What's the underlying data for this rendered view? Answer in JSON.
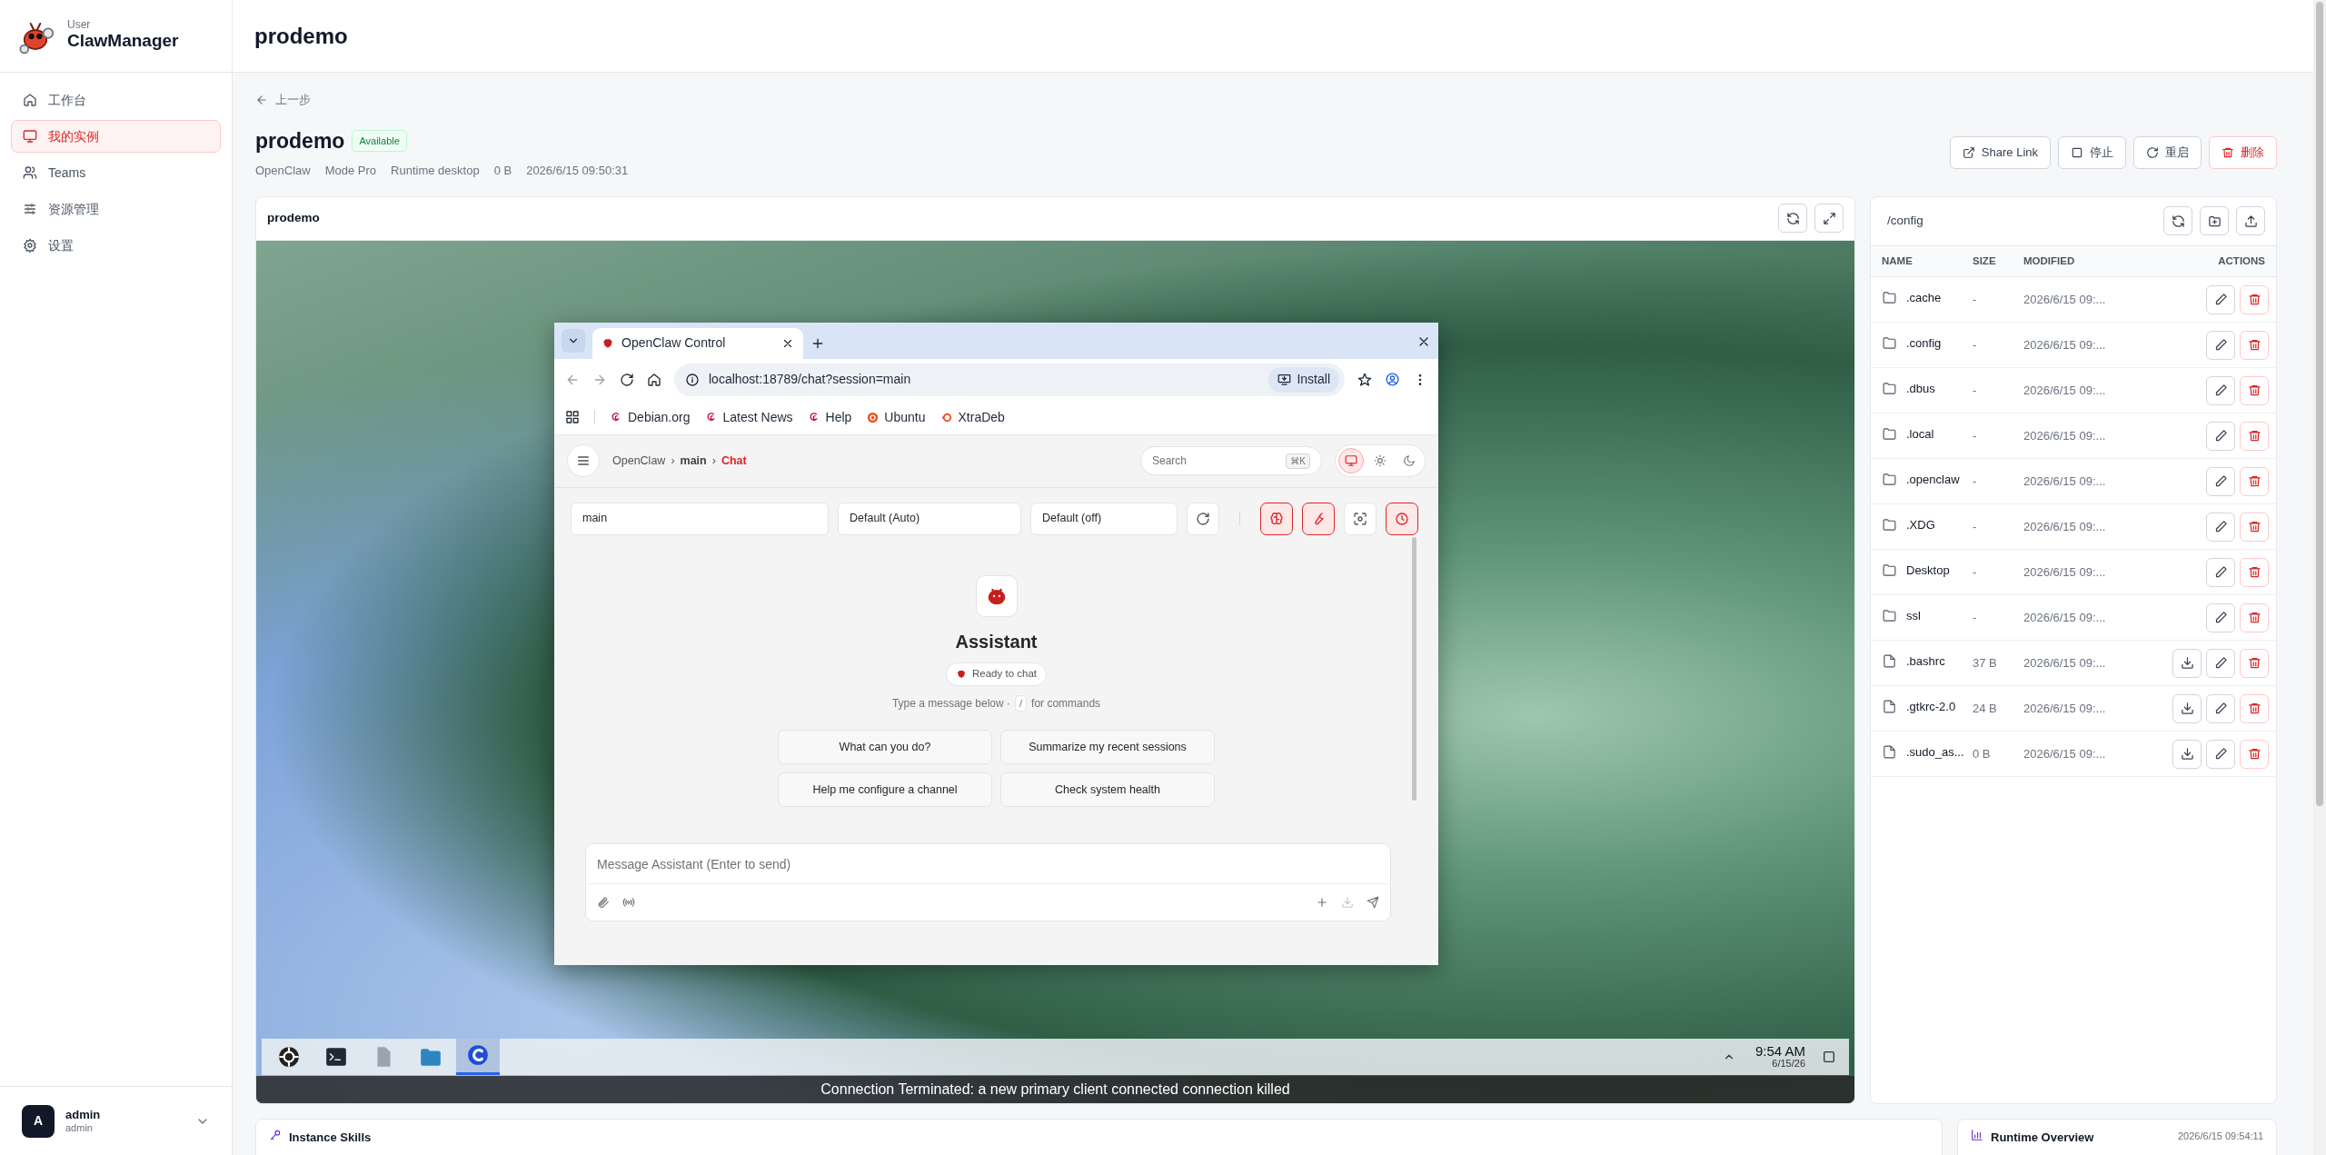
{
  "sidebar": {
    "role": "User",
    "brand": "ClawManager",
    "items": [
      {
        "label": "工作台",
        "selected": false
      },
      {
        "label": "我的实例",
        "selected": true
      },
      {
        "label": "Teams",
        "selected": false
      },
      {
        "label": "资源管理",
        "selected": false
      },
      {
        "label": "设置",
        "selected": false
      }
    ],
    "user": {
      "avatar": "A",
      "name": "admin",
      "role": "admin"
    }
  },
  "header": {
    "title": "prodemo"
  },
  "back": "上一步",
  "instance": {
    "name": "prodemo",
    "status": "Available",
    "meta": [
      "OpenClaw",
      "Mode Pro",
      "Runtime desktop",
      "0 B",
      "2026/6/15 09:50:31"
    ]
  },
  "actions": [
    {
      "label": "Share Link",
      "kind": "share"
    },
    {
      "label": "停止",
      "kind": "stop"
    },
    {
      "label": "重启",
      "kind": "restart"
    },
    {
      "label": "删除",
      "kind": "delete"
    }
  ],
  "desktop": {
    "title": "prodemo",
    "browser": {
      "tab": "OpenClaw Control",
      "url": "localhost:18789/chat?session=main",
      "install": "Install",
      "bookmarks": [
        {
          "label": "Debian.org",
          "kind": "debian"
        },
        {
          "label": "Latest News",
          "kind": "debian"
        },
        {
          "label": "Help",
          "kind": "debian"
        },
        {
          "label": "Ubuntu",
          "kind": "ubuntu"
        },
        {
          "label": "XtraDeb",
          "kind": "xtradeb"
        }
      ],
      "breadcrumb": [
        {
          "kind": "root",
          "text": "OpenClaw"
        },
        {
          "kind": "separator",
          "text": "›"
        },
        {
          "kind": "session",
          "text": "main"
        },
        {
          "kind": "separator",
          "text": "›"
        },
        {
          "kind": "current",
          "text": "Chat"
        }
      ],
      "search": {
        "placeholder": "Search",
        "shortcut": "⌘K"
      },
      "themes": [
        {
          "kind": "system",
          "selected": true
        },
        {
          "kind": "light",
          "selected": false
        },
        {
          "kind": "dark",
          "selected": false
        }
      ],
      "selectors": [
        "main",
        "Default (Auto)",
        "Default (off)"
      ],
      "tools": [
        {
          "kind": "brain",
          "active": true
        },
        {
          "kind": "wrench",
          "active": true
        },
        {
          "kind": "focus",
          "active": false
        },
        {
          "kind": "clock",
          "active": true
        }
      ],
      "assistant": "Assistant",
      "status": "Ready to chat",
      "hint": {
        "before": "Type a message below ·",
        "key": "/",
        "after": "for commands"
      },
      "suggestions": [
        "What can you do?",
        "Summarize my recent sessions",
        "Help me configure a channel",
        "Check system health"
      ],
      "composer": {
        "placeholder": "Message Assistant (Enter to send)"
      }
    },
    "taskbar": {
      "apps": [
        {
          "kind": "settings",
          "selected": false
        },
        {
          "kind": "terminal",
          "selected": false
        },
        {
          "kind": "files",
          "selected": false
        },
        {
          "kind": "folder",
          "selected": false
        },
        {
          "kind": "browser",
          "selected": true
        }
      ],
      "time": "9:54 AM",
      "date": "6/15/26"
    },
    "notice": "Connection Terminated: a new primary client connected connection killed"
  },
  "files": {
    "path": "/config",
    "columns": [
      "NAME",
      "SIZE",
      "MODIFIED",
      "ACTIONS"
    ],
    "rows": [
      {
        "kind": "folder",
        "name": ".cache",
        "size": "-",
        "modified": "2026/6/15 09:..."
      },
      {
        "kind": "folder",
        "name": ".config",
        "size": "-",
        "modified": "2026/6/15 09:..."
      },
      {
        "kind": "folder",
        "name": ".dbus",
        "size": "-",
        "modified": "2026/6/15 09:..."
      },
      {
        "kind": "folder",
        "name": ".local",
        "size": "-",
        "modified": "2026/6/15 09:..."
      },
      {
        "kind": "folder",
        "name": ".openclaw",
        "size": "-",
        "modified": "2026/6/15 09:..."
      },
      {
        "kind": "folder",
        "name": ".XDG",
        "size": "-",
        "modified": "2026/6/15 09:..."
      },
      {
        "kind": "folder",
        "name": "Desktop",
        "size": "-",
        "modified": "2026/6/15 09:..."
      },
      {
        "kind": "folder",
        "name": "ssl",
        "size": "-",
        "modified": "2026/6/15 09:..."
      },
      {
        "kind": "file",
        "name": ".bashrc",
        "size": "37 B",
        "modified": "2026/6/15 09:..."
      },
      {
        "kind": "file",
        "name": ".gtkrc-2.0",
        "size": "24 B",
        "modified": "2026/6/15 09:..."
      },
      {
        "kind": "file",
        "name": ".sudo_as...",
        "size": "0 B",
        "modified": "2026/6/15 09:..."
      }
    ]
  },
  "skills": {
    "title": "Instance Skills"
  },
  "runtime": {
    "title": "Runtime Overview",
    "time": "2026/6/15 09:54:11"
  }
}
